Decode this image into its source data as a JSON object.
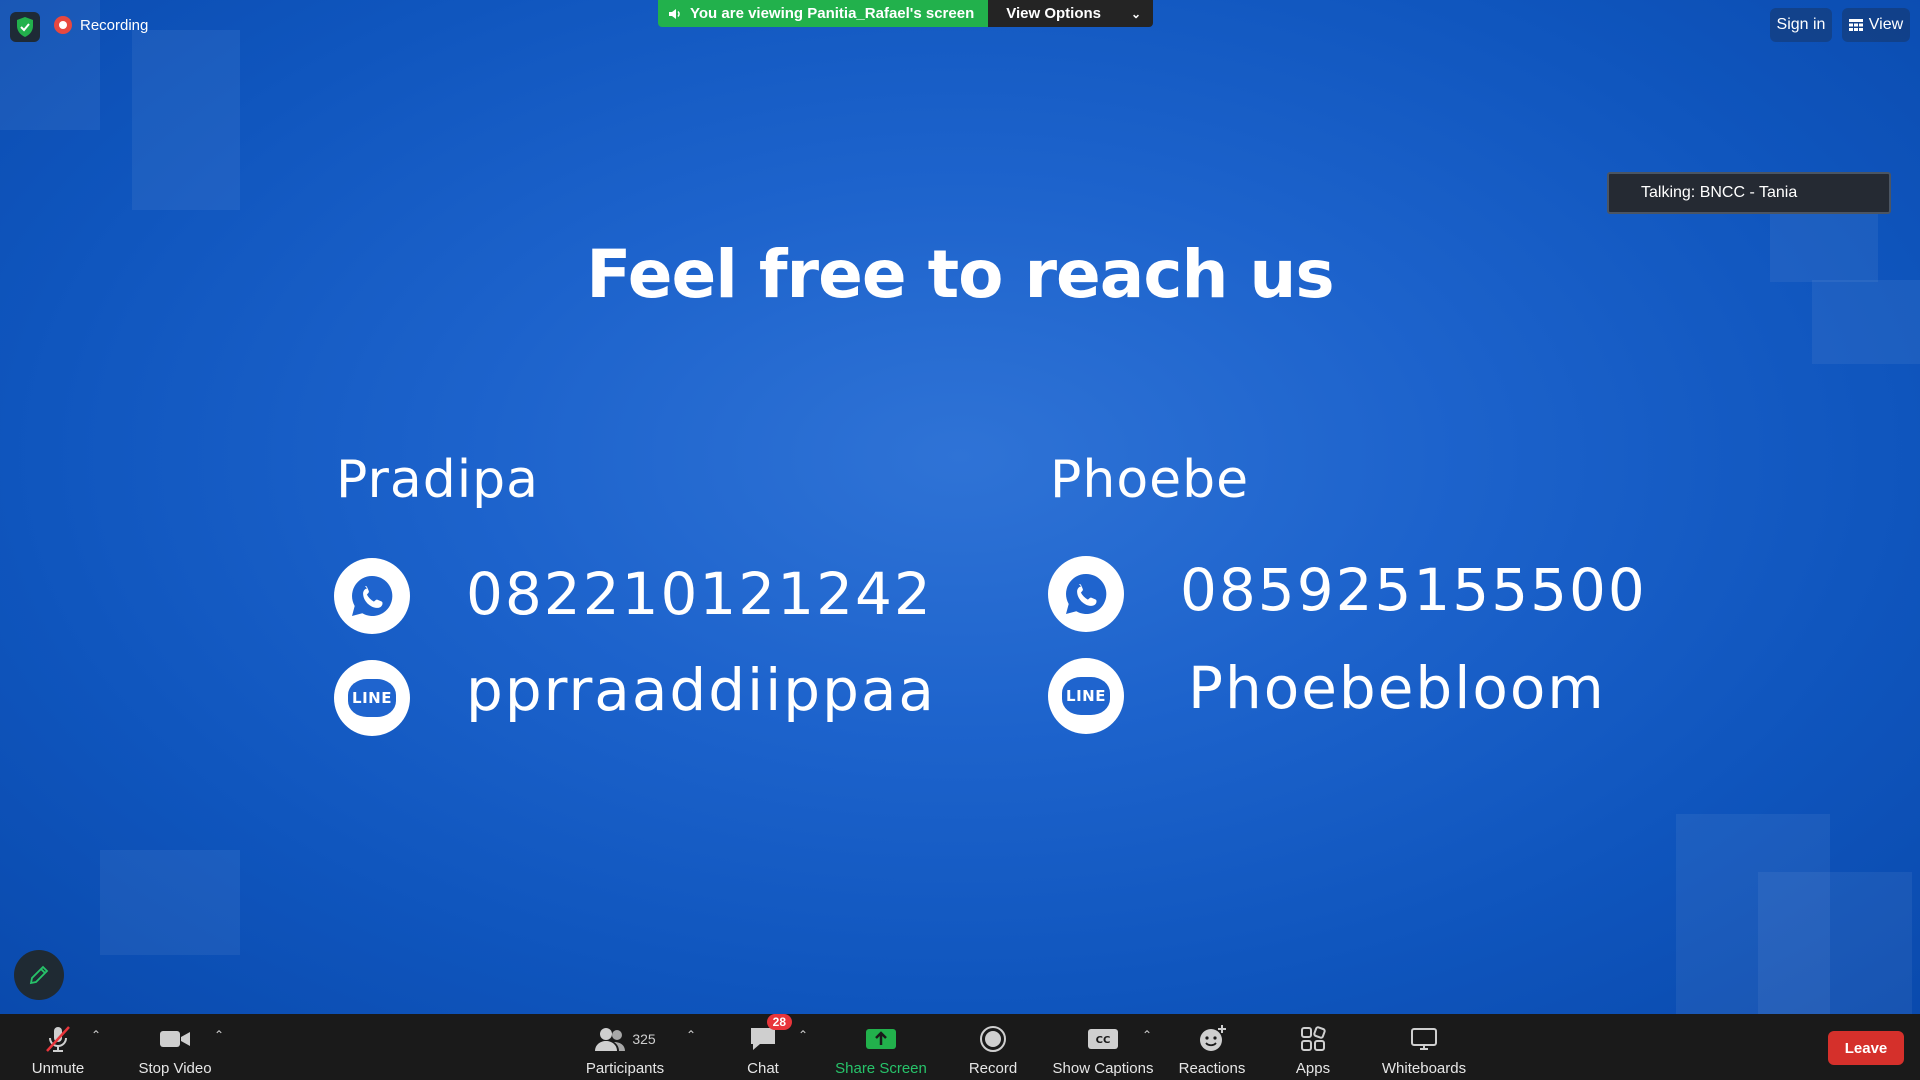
{
  "top_bar": {
    "recording_label": "Recording",
    "viewing_text": "You are viewing Panitia_Rafael's screen",
    "view_options_label": "View Options",
    "sign_in_label": "Sign in",
    "view_label": "View"
  },
  "talking_indicator": "Talking: BNCC - Tania",
  "slide": {
    "title": "Feel free to reach us",
    "contacts": [
      {
        "name": "Pradipa",
        "whatsapp": "082210121242",
        "line": "pprraaddiippaa"
      },
      {
        "name": "Phoebe",
        "whatsapp": "085925155500",
        "line": "Phoebebloom"
      }
    ],
    "line_badge_text": "LINE"
  },
  "toolbar": {
    "unmute": "Unmute",
    "stop_video": "Stop Video",
    "participants": "Participants",
    "participant_count": "325",
    "chat": "Chat",
    "chat_badge": "28",
    "share_screen": "Share Screen",
    "record": "Record",
    "show_captions": "Show Captions",
    "reactions": "Reactions",
    "apps": "Apps",
    "whiteboards": "Whiteboards",
    "leave": "Leave"
  },
  "colors": {
    "share_green": "#22b14c",
    "leave_red": "#d5302b",
    "slide_blue": "#1d63cc"
  }
}
